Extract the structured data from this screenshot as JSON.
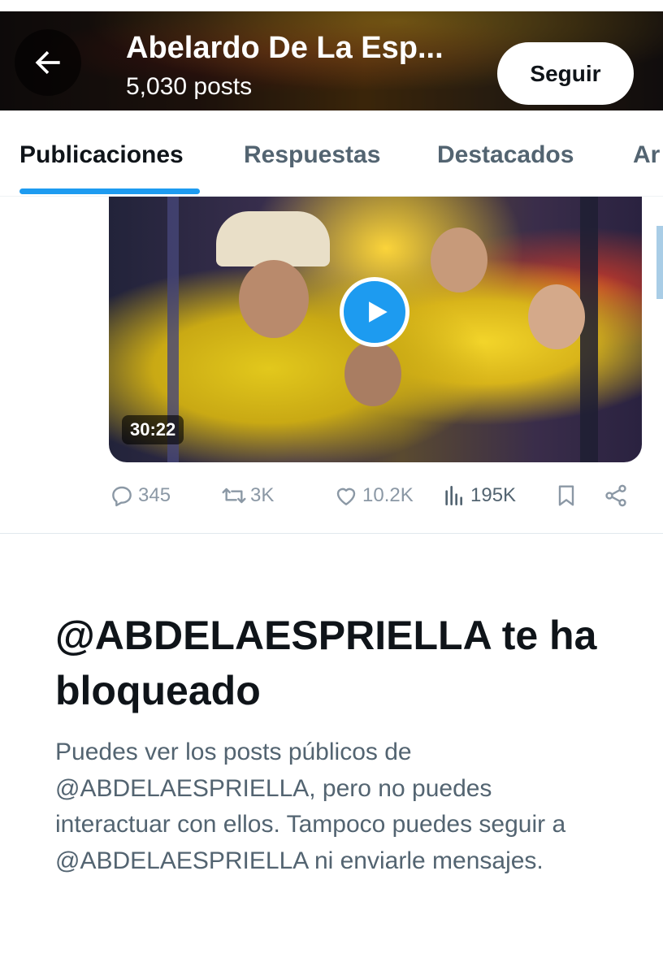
{
  "header": {
    "profile_name": "Abelardo De La Esp...",
    "post_count": "5,030 posts",
    "follow_label": "Seguir",
    "back_icon": "arrow-left-icon"
  },
  "tabs": [
    {
      "label": "Publicaciones",
      "active": true
    },
    {
      "label": "Respuestas",
      "active": false
    },
    {
      "label": "Destacados",
      "active": false
    },
    {
      "label": "Ar",
      "active": false
    }
  ],
  "post": {
    "video_duration": "30:22",
    "play_icon": "play-icon",
    "replies": "345",
    "reposts": "3K",
    "likes": "10.2K",
    "views": "195K"
  },
  "blocked": {
    "title": "@ABDELAESPRIELLA te ha bloqueado",
    "description": "Puedes ver los posts públicos de @ABDELAESPRIELLA, pero no puedes interactuar con ellos. Tampoco puedes seguir a @ABDELAESPRIELLA ni enviarle mensajes."
  },
  "colors": {
    "accent": "#1d9bf0",
    "text_primary": "#0f1419",
    "text_secondary": "#536471",
    "icon_muted": "#8b98a5"
  }
}
